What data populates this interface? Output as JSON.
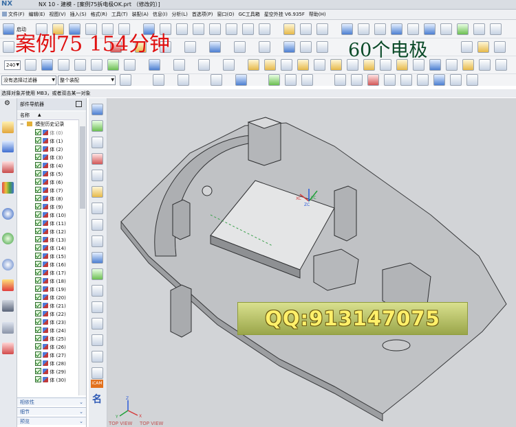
{
  "window": {
    "logo": "NX",
    "title": "NX 10 - 建模 - [案例75拆电极OK.prt （修改的）]"
  },
  "menu": [
    "文件(F)",
    "编辑(E)",
    "视图(V)",
    "插入(S)",
    "格式(R)",
    "工具(T)",
    "装配(A)",
    "信息(I)",
    "分析(L)",
    "首选项(P)",
    "窗口(O)",
    "GC工具箱",
    "星空外挂 V6.935F",
    "帮助(H)"
  ],
  "toolbar": {
    "start_label": "启动",
    "zoom_value": "240",
    "filter_value": "没有选择过滤器",
    "assembly_value": "整个装配"
  },
  "overlays": {
    "case_label": "案例75   154分钟",
    "electrode_label": "60个电极"
  },
  "cue_line": "选择对象并使用 MB3，或者双击某一对象",
  "navigator": {
    "title": "部件导航器",
    "column_name": "名称",
    "root": "模型历史记录",
    "items": [
      "体 (0)",
      "体 (1)",
      "体 (2)",
      "体 (3)",
      "体 (4)",
      "体 (5)",
      "体 (6)",
      "体 (7)",
      "体 (8)",
      "体 (9)",
      "体 (10)",
      "体 (11)",
      "体 (12)",
      "体 (13)",
      "体 (14)",
      "体 (15)",
      "体 (16)",
      "体 (17)",
      "体 (18)",
      "体 (19)",
      "体 (20)",
      "体 (21)",
      "体 (22)",
      "体 (23)",
      "体 (24)",
      "体 (25)",
      "体 (26)",
      "体 (27)",
      "体 (28)",
      "体 (29)",
      "体 (30)"
    ],
    "sections": [
      "相依性",
      "细节",
      "预览"
    ]
  },
  "viewport": {
    "top_view_1": "TOP VIEW",
    "top_view_2": "TOP VIEW",
    "axis_x": "X",
    "axis_y": "Y",
    "axis_z": "Z",
    "origin_x": "XC",
    "origin_y": "YC",
    "origin_z": "ZC"
  },
  "watermark": {
    "qq_text": "QQ:913147075"
  },
  "midrail": {
    "icam_label": "iCAM",
    "name_label": "名"
  },
  "colors": {
    "viewport_bg": "#d2d4d7",
    "model_face": "#b9bbbe",
    "accent_blue": "#3a6ea5",
    "overlay_red": "#e01010"
  }
}
